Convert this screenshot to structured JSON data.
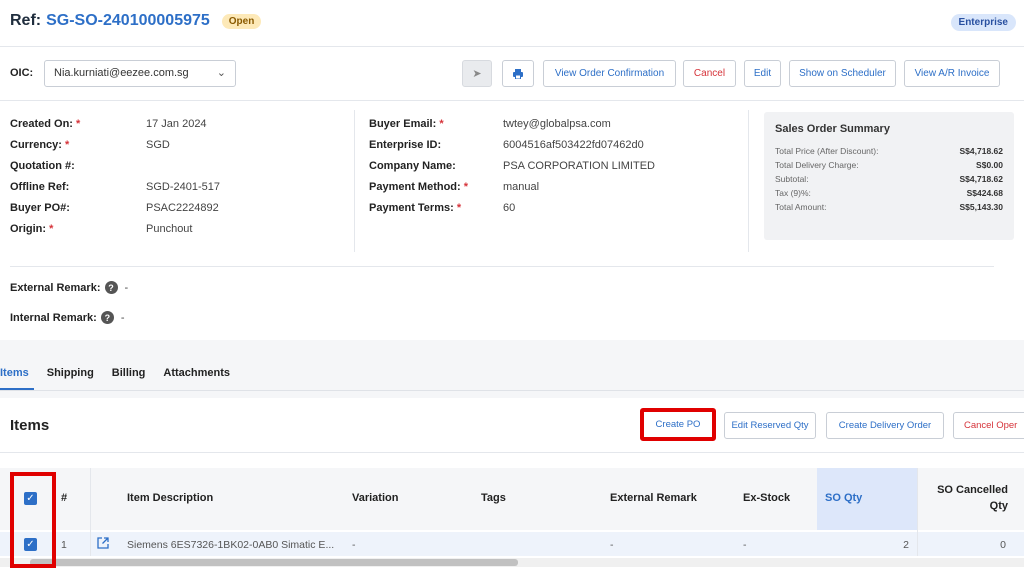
{
  "header": {
    "ref_label": "Ref:",
    "ref_id": "SG-SO-240100005975",
    "status": "Open",
    "type_badge": "Enterprise"
  },
  "toolbar": {
    "oic_label": "OIC:",
    "oic_value": "Nia.kurniati@eezee.com.sg",
    "view_order_confirmation": "View Order Confirmation",
    "cancel": "Cancel",
    "edit": "Edit",
    "show_on_scheduler": "Show on Scheduler",
    "view_ar_invoice": "View A/R Invoice"
  },
  "details_left": [
    {
      "label": "Created On:",
      "required": true,
      "value": "17 Jan 2024"
    },
    {
      "label": "Currency:",
      "required": true,
      "value": "SGD"
    },
    {
      "label": "Quotation #:",
      "required": false,
      "value": ""
    },
    {
      "label": "Offline Ref:",
      "required": false,
      "value": "SGD-2401-517"
    },
    {
      "label": "Buyer PO#:",
      "required": false,
      "value": "PSAC2224892"
    },
    {
      "label": "Origin:",
      "required": true,
      "value": "Punchout"
    }
  ],
  "details_mid": [
    {
      "label": "Buyer Email:",
      "required": true,
      "value": "twtey@globalpsa.com"
    },
    {
      "label": "Enterprise ID:",
      "required": false,
      "value": "6004516af503422fd07462d0"
    },
    {
      "label": "Company Name:",
      "required": false,
      "value": "PSA CORPORATION LIMITED"
    },
    {
      "label": "Payment Method:",
      "required": true,
      "value": "manual"
    },
    {
      "label": "Payment Terms:",
      "required": true,
      "value": "60"
    }
  ],
  "summary": {
    "title": "Sales Order Summary",
    "rows": [
      {
        "label": "Total Price (After Discount):",
        "value": "S$4,718.62"
      },
      {
        "label": "Total Delivery Charge:",
        "value": "S$0.00"
      },
      {
        "label": "Subtotal:",
        "value": "S$4,718.62"
      },
      {
        "label": "Tax (9)%:",
        "value": "S$424.68"
      },
      {
        "label": "Total Amount:",
        "value": "S$5,143.30"
      }
    ]
  },
  "remarks": {
    "external_label": "External Remark:",
    "external_value": "-",
    "internal_label": "Internal Remark:",
    "internal_value": "-"
  },
  "tabs": [
    "Items",
    "Shipping",
    "Billing",
    "Attachments"
  ],
  "items_panel": {
    "title": "Items",
    "create_po": "Create PO",
    "edit_reserved_qty": "Edit Reserved Qty",
    "create_delivery_order": "Create Delivery Order",
    "cancel_open": "Cancel Oper"
  },
  "table": {
    "columns": {
      "num": "#",
      "item_description": "Item Description",
      "variation": "Variation",
      "tags": "Tags",
      "external_remark": "External Remark",
      "ex_stock": "Ex-Stock",
      "so_qty": "SO Qty",
      "so_cancelled_qty_1": "SO Cancelled",
      "so_cancelled_qty_2": "Qty"
    },
    "rows": [
      {
        "num": "1",
        "item_description": "Siemens 6ES7326-1BK02-0AB0 Simatic E...",
        "variation": "-",
        "tags": "",
        "external_remark": "-",
        "ex_stock": "-",
        "so_qty": "2",
        "so_cancelled_qty": "0"
      }
    ]
  },
  "colors": {
    "accent": "#2d6fc7",
    "danger": "#d6333a",
    "highlight": "#e00000"
  }
}
